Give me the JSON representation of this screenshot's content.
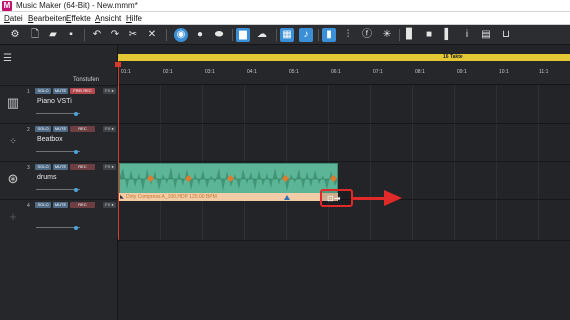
{
  "window": {
    "title": "Music Maker (64-Bit) - New.mmm*"
  },
  "menu": [
    "Datei",
    "Bearbeiten",
    "Effekte",
    "Ansicht",
    "Hilfe"
  ],
  "timeline": {
    "loop_label": "16 Takte",
    "ticks": [
      "01:1",
      "02:1",
      "03:1",
      "04:1",
      "05:1",
      "06:1",
      "07:1",
      "08:1",
      "09:1",
      "10:1",
      "11:1"
    ]
  },
  "panel": {
    "tonstufen": "Tonstufen"
  },
  "tracks": [
    {
      "num": "1",
      "name": "Piano VSTi",
      "solo": "SOLO",
      "mute": "MUTE",
      "rec": "FREI REC",
      "fx": "FX ●",
      "icon": "piano-icon"
    },
    {
      "num": "2",
      "name": "Beatbox",
      "solo": "SOLO",
      "mute": "MUTE",
      "rec": "REC",
      "fx": "FX ●",
      "icon": "beatbox-icon"
    },
    {
      "num": "3",
      "name": "drums",
      "solo": "SOLO",
      "mute": "MUTE",
      "rec": "REC",
      "fx": "FX ●",
      "icon": "drums-icon"
    },
    {
      "num": "4",
      "name": "",
      "solo": "SOLO",
      "mute": "MUTE",
      "rec": "REC",
      "fx": "FX ●",
      "icon": "empty-track-icon"
    }
  ],
  "clip": {
    "label": "Dirty Compress A_100.HDP    125.00 BPM",
    "corner": "◣"
  },
  "colors": {
    "accent": "#3b8fd6",
    "loop": "#e4c735",
    "clip": "#5bb596",
    "annotation": "#e02a2a"
  }
}
